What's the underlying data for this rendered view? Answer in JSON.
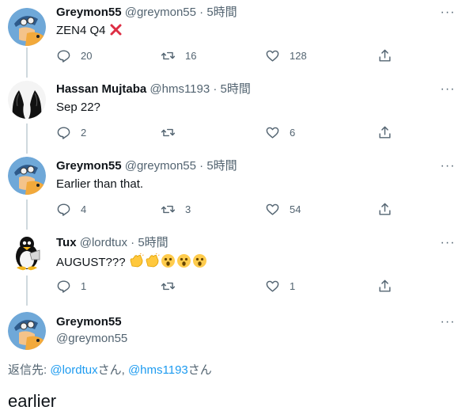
{
  "tweets": [
    {
      "name": "Greymon55",
      "handle": "@greymon55",
      "dot": "·",
      "time": "5時間",
      "text": "ZEN4 Q4",
      "reply_count": "20",
      "retweet_count": "16",
      "like_count": "128"
    },
    {
      "name": "Hassan Mujtaba",
      "handle": "@hms1193",
      "dot": "·",
      "time": "5時間",
      "text": "Sep 22?",
      "reply_count": "2",
      "retweet_count": "",
      "like_count": "6"
    },
    {
      "name": "Greymon55",
      "handle": "@greymon55",
      "dot": "·",
      "time": "5時間",
      "text": "Earlier than that.",
      "reply_count": "4",
      "retweet_count": "3",
      "like_count": "54"
    },
    {
      "name": "Tux",
      "handle": "@lordtux",
      "dot": "·",
      "time": "5時間",
      "text": "AUGUST???",
      "reply_count": "1",
      "retweet_count": "",
      "like_count": "1"
    }
  ],
  "focused": {
    "name": "Greymon55",
    "handle": "@greymon55"
  },
  "reply_to": {
    "prefix": "返信先: ",
    "user1": "@lordtux",
    "suffix1": "さん, ",
    "user2": "@hms1193",
    "suffix2": "さん"
  },
  "compose_text": "earlier",
  "icons": [
    "more-icon",
    "reply-icon",
    "retweet-icon",
    "like-icon",
    "share-icon",
    "cross-mark-emoji",
    "clapping-hands-emoji",
    "astonished-face-emoji"
  ],
  "colors": {
    "link": "#1d9bf0",
    "muted": "#536471",
    "text": "#0f1419",
    "thread_line": "#cfd9de"
  }
}
